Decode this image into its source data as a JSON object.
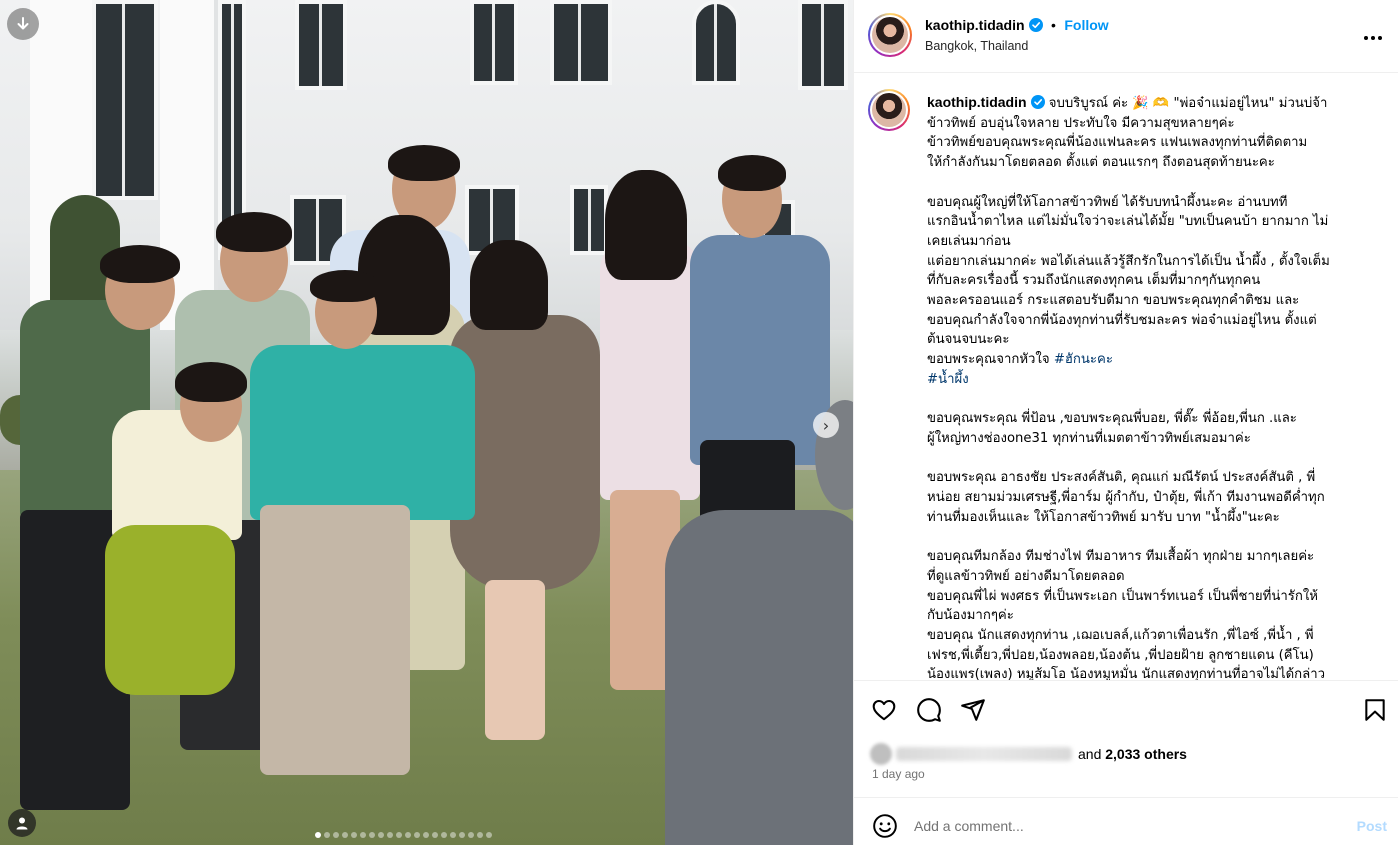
{
  "post": {
    "username": "kaothip.tidadin",
    "follow_label": "Follow",
    "separator": "•",
    "location": "Bangkok, Thailand",
    "more_label": "•••"
  },
  "caption": {
    "username": "kaothip.tidadin",
    "lines": [
      "จบบริบูรณ์ ค่ะ 🎉 🫶 \"พ่อจ๋าแม่อยู่ไหน\" ม่วนบ่จ้า",
      "ข้าวทิพย์ อบอุ่นใจหลาย ประทับใจ มีความสุขหลายๆค่ะ",
      "ข้าวทิพย์ขอบคุณพระคุณพี่น้องแฟนละคร แฟนเพลงทุกท่านที่ติดตาม",
      "ให้กำลังกันมาโดยตลอด ตั้งแต่ ตอนแรกๆ ถึงตอนสุดท้ายนะคะ",
      "",
      "ขอบคุณผู้ใหญ่ที่ให้โอกาสข้าวทิพย์ ได้รับบทนำผึ้งนะคะ อ่านบทที",
      "แรกอินน้ำตาไหล แต่ไม่มั่นใจว่าจะเล่นได้มั้ย \"บทเป็นคนบ้า ยากมาก ไม่",
      "เคยเล่นมาก่อน",
      "แต่อยากเล่นมากค่ะ พอได้เล่นแล้วรู้สึกรักในการได้เป็น น้ำผึ้ง , ตั้งใจเต็ม",
      "ที่กับละครเรื่องนี้ รวมถึงนักแสดงทุกคน เต็มที่มากๆกันทุกคน",
      "พอละครออนแอร์ กระแสตอบรับดีมาก ขอบพระคุณทุกคำติชม และ",
      "ขอบคุณกำลังใจจากพี่น้องทุกท่านที่รับชมละคร พ่อจ๋าแม่อยู่ไหน ตั้งแต่",
      "ต้นจนจบนะคะ",
      "ขอบพระคุณจากหัวใจ"
    ],
    "hashtag_1": "#ฮักนะคะ",
    "hashtag_2": "#น้ำผึ้ง",
    "lines_2": [
      "",
      "ขอบคุณพระคุณ พี่ป้อน ,ขอบพระคุณพี่บอย, พี่ตั๊ะ พี่อ้อย,พี่นก .และ",
      "ผู้ใหญ่ทางช่องone31 ทุกท่านที่เมตตาข้าวทิพย์เสมอมาค่ะ",
      "",
      "ขอบพระคุณ อาธงชัย ประสงค์สันติ, คุณแก่ มณีรัตน์ ประสงค์สันติ , พี่",
      "หน่อย สยามม่วมเศรษฐี,พี่อาร์ม ผู้กำกับ, ป๋าตุ้ย, พี่เก้า ทีมงานพอดีค่ำทุก",
      "ท่านที่มองเห็นและ ให้โอกาสข้าวทิพย์ มารับ บาท \"น้ำผึ้ง\"นะคะ",
      "",
      "ขอบคุณทีมกล้อง ทีมช่างไฟ ทีมอาหาร ทีมเสื้อผ้า ทุกฝ่าย มากๆเลยค่ะ",
      "ที่ดูแลข้าวทิพย์ อย่างดีมาโดยตลอด",
      "ขอบคุณพี่ไผ่ พงศธร ที่เป็นพระเอก เป็นพาร์ทเนอร์ เป็นพี่ชายที่น่ารักให้",
      "กับน้องมากๆค่ะ",
      "ขอบคุณ นักแสดงทุกท่าน ,เฌอเบลล์,แก้วตาเพื่อนรัก ,พี่ไอซ์ ,พี่น้ำ , พี่",
      "เฟรช,พี่เตี้ยว,พี่ปอย,น้องพลอย,น้องต้น ,พี่ปอยฝ้าย ลูกชายแดน (คีโน)",
      "น้องแพร(เพลง) หมูส้มโอ น้องหมูหมั่น นักแสดงทุกท่านที่อาจไม่ได้กล่าว"
    ]
  },
  "engagement": {
    "likes_text": "and",
    "likes_count": "2,033 others",
    "time_ago": "1 day ago"
  },
  "comment": {
    "placeholder": "Add a comment...",
    "post_label": "Post"
  },
  "carousel": {
    "total_slides": 20,
    "active_index": 0
  },
  "colors": {
    "accent": "#0095f6",
    "hashtag": "#00376b",
    "muted": "#737373",
    "post_disabled": "#b3dbff"
  },
  "icons": {
    "like": "heart-icon",
    "comment": "comment-bubble-icon",
    "share": "paper-plane-icon",
    "save": "bookmark-icon",
    "emoji": "smiley-icon",
    "tag": "user-tag-icon",
    "next": "chevron-right-icon",
    "audio": "download-arrow-icon",
    "verified": "verified-badge-icon"
  }
}
